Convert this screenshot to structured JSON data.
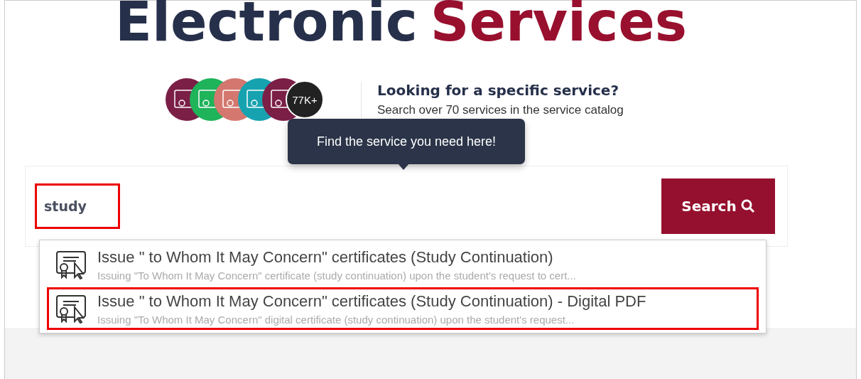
{
  "title": {
    "first": "Electronic",
    "second": "Services"
  },
  "avatars": [
    {
      "color": "#7b1f47"
    },
    {
      "color": "#1fb35a"
    },
    {
      "color": "#d4786f"
    },
    {
      "color": "#17a2b0"
    },
    {
      "color": "#7b1f47"
    }
  ],
  "count_badge": "77K+",
  "promo": {
    "heading": "Looking for a specific service?",
    "text": "Search over 70 services in the service catalog"
  },
  "tooltip": "Find the service you need here!",
  "search": {
    "value": "study",
    "highlighted": true,
    "button": "Search"
  },
  "suggestions": [
    {
      "title": "Issue \" to Whom It May Concern\" certificates (Study Continuation)",
      "description": "Issuing \"To Whom It May Concern\" certificate (study continuation) upon the student's request to cert...",
      "highlighted": false
    },
    {
      "title": "Issue \" to Whom It May Concern\" certificates (Study Continuation) - Digital PDF",
      "description": "Issuing \"To Whom It May Concern\" digital certificate (study continuation) upon the student's request...",
      "highlighted": true
    }
  ]
}
